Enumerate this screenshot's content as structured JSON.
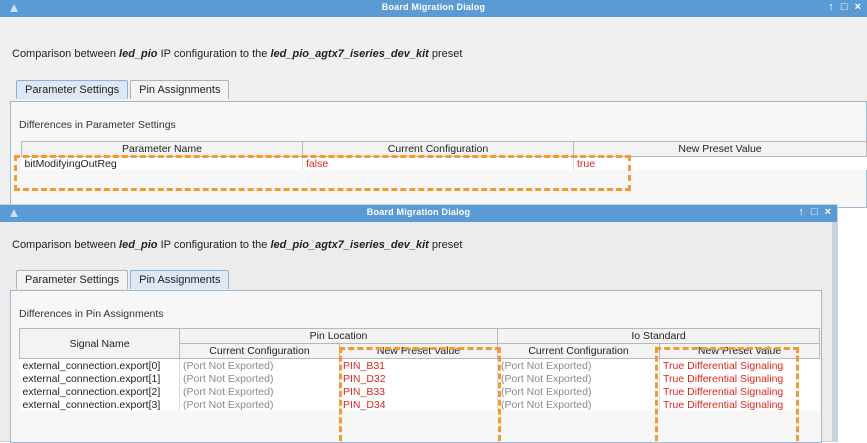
{
  "window1": {
    "title": "Board Migration Dialog",
    "ctrl_up": "↑",
    "ctrl_max": "□",
    "ctrl_close": "×",
    "desc_pre": "Comparison between ",
    "desc_ip": "led_pio",
    "desc_mid": " IP configuration to the ",
    "desc_preset": "led_pio_agtx7_iseries_dev_kit",
    "desc_post": " preset",
    "tabs": [
      "Parameter Settings",
      "Pin Assignments"
    ],
    "section_title": "Differences in Parameter Settings",
    "headers": [
      "Parameter Name",
      "Current Configuration",
      "New Preset Value"
    ],
    "rows": [
      {
        "name": "bitModifyingOutReg",
        "current": "false",
        "new": "true"
      }
    ]
  },
  "window2": {
    "title": "Board Migration Dialog",
    "ctrl_up": "↑",
    "ctrl_max": "□",
    "ctrl_close": "×",
    "desc_pre": "Comparison between ",
    "desc_ip": "led_pio",
    "desc_mid": " IP configuration to the ",
    "desc_preset": "led_pio_agtx7_iseries_dev_kit",
    "desc_post": " preset",
    "tabs": [
      "Parameter Settings",
      "Pin Assignments"
    ],
    "section_title": "Differences in Pin Assignments",
    "group_headers": [
      "Signal Name",
      "Pin Location",
      "Io Standard"
    ],
    "sub_headers": [
      "Current Configuration",
      "New Preset Value",
      "Current Configuration",
      "New Preset Value"
    ],
    "rows": [
      {
        "signal": "external_connection.export[0]",
        "pin_cur": "(Port Not Exported)",
        "pin_new": "PIN_B31",
        "io_cur": "(Port Not Exported)",
        "io_new": "True Differential Signaling"
      },
      {
        "signal": "external_connection.export[1]",
        "pin_cur": "(Port Not Exported)",
        "pin_new": "PIN_D32",
        "io_cur": "(Port Not Exported)",
        "io_new": "True Differential Signaling"
      },
      {
        "signal": "external_connection.export[2]",
        "pin_cur": "(Port Not Exported)",
        "pin_new": "PIN_B33",
        "io_cur": "(Port Not Exported)",
        "io_new": "True Differential Signaling"
      },
      {
        "signal": "external_connection.export[3]",
        "pin_cur": "(Port Not Exported)",
        "pin_new": "PIN_D34",
        "io_cur": "(Port Not Exported)",
        "io_new": "True Differential Signaling"
      }
    ]
  },
  "colors": {
    "titlebar": "#5b9bd5",
    "highlight": "#f29a36",
    "changed_value": "#e0251f"
  }
}
